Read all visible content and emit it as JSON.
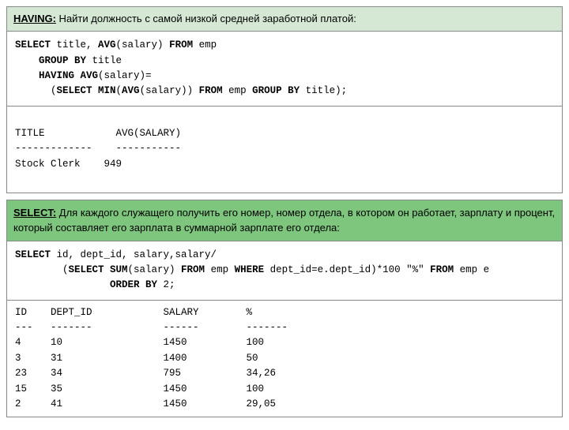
{
  "having_section": {
    "header_label": "HAVING:",
    "header_text": " Найти должность с самой низкой средней заработной платой:",
    "code": "SELECT title, AVG(salary) FROM emp\n    GROUP BY title\n    HAVING AVG(salary)=\n      (SELECT MIN(AVG(salary)) FROM emp GROUP BY title);",
    "result_header": "TITLE            AVG(SALARY)\n-------------    -----------",
    "result_data": "Stock Clerk    949"
  },
  "select_section": {
    "header_label": "SELECT:",
    "header_text": " Для каждого служащего получить его номер, номер отдела, в котором он работает, зарплату и процент, который составляет его зарплата в суммарной зарплате его отдела:",
    "code_line1": "SELECT id, dept_id, salary,salary/",
    "code_line2": "        (SELECT SUM(salary) FROM emp WHERE dept_id=e.dept_id)*100 \"%\"",
    "code_line3": "        FROM emp e",
    "code_line4": "                ORDER BY 2;",
    "result_header": "ID    DEPT_ID            SALARY        %\n---   -------            ------        -------",
    "result_rows": [
      {
        "id": "4",
        "dept_id": "10",
        "salary": "1450",
        "pct": "100"
      },
      {
        "id": "3",
        "dept_id": "31",
        "salary": "1400",
        "pct": "50"
      },
      {
        "id": "23",
        "dept_id": "34",
        "salary": "795",
        "pct": "34,26"
      },
      {
        "id": "15",
        "dept_id": "35",
        "salary": "1450",
        "pct": "100"
      },
      {
        "id": "2",
        "dept_id": "41",
        "salary": "1450",
        "pct": "29,05"
      }
    ]
  }
}
